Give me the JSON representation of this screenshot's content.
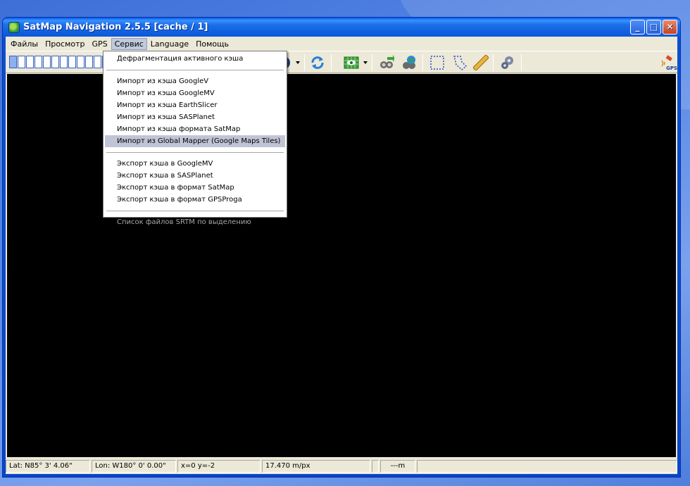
{
  "window": {
    "title": "SatMap Navigation 2.5.5  [cache / 1]"
  },
  "menubar": {
    "items": [
      "Файлы",
      "Просмотр",
      "GPS",
      "Сервис",
      "Language",
      "Помощь"
    ],
    "active_index": 3
  },
  "toolbar": {
    "zoom_levels": 12,
    "zoom_selected": 1,
    "gps_label": "GPS"
  },
  "service_menu": {
    "groups": [
      [
        "Дефрагментация активного кэша"
      ],
      [
        "Импорт из кэша GoogleV",
        "Импорт из кэша GoogleMV",
        "Импорт из кэша EarthSlicer",
        "Импорт из кэша SASPlanet",
        "Импорт из кэша формата SatMap",
        "Импорт из Global Mapper (Google Maps Tiles)"
      ],
      [
        "Экспорт кэша в GoogleMV",
        "Экспорт кэша в SASPlanet",
        "Экспорт кэша в формат SatMap",
        "Экспорт кэша в формат GPSProga"
      ],
      [
        "Список файлов SRTM по выделению"
      ]
    ],
    "highlighted": "Импорт из Global Mapper (Google Maps Tiles)",
    "disabled": [
      "Список файлов SRTM по выделению"
    ]
  },
  "statusbar": {
    "lat": "Lat: N85° 3' 4.06\"",
    "lon": "Lon: W180° 0' 0.00\"",
    "xy": "x=0 y=-2",
    "scale": "17.470 m/px",
    "empty": "",
    "distance": "---m"
  },
  "colors": {
    "map_background": "#000000",
    "menu_highlight": "#c1c4d6",
    "title_bar": "#0a55d9"
  }
}
